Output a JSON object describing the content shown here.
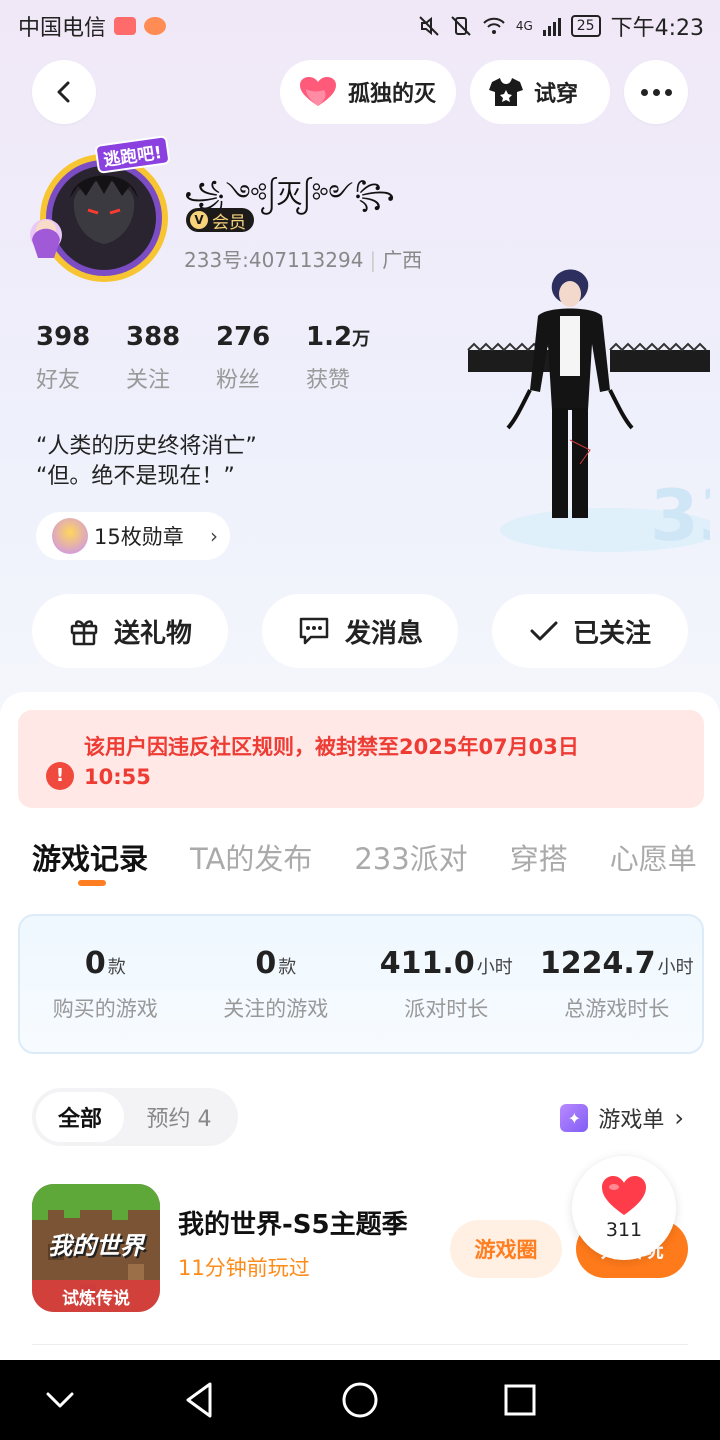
{
  "status_bar": {
    "carrier": "中国电信",
    "network": "4G",
    "battery": "25",
    "time": "下午4:23"
  },
  "header": {
    "favorite_label": "孤独的灭",
    "try_on_label": "试穿"
  },
  "profile": {
    "avatar_frame_text": "逃跑吧!",
    "nickname": "꧁༺ᩭ灭ᩭ༻꧂",
    "vip_label": "会员",
    "id_text": "233号:407113294",
    "region": "广西",
    "stats": [
      {
        "num": "398",
        "unit": "",
        "label": "好友"
      },
      {
        "num": "388",
        "unit": "",
        "label": "关注"
      },
      {
        "num": "276",
        "unit": "",
        "label": "粉丝"
      },
      {
        "num": "1.2",
        "unit": "万",
        "label": "获赞"
      }
    ],
    "bio_line1": "“人类的历史终将消亡”",
    "bio_line2": "“但。绝不是现在！”",
    "badges_label": "15枚勋章"
  },
  "actions": {
    "gift": "送礼物",
    "message": "发消息",
    "follow": "已关注"
  },
  "ban_notice": {
    "line1": "该用户因违反社区规则，被封禁至2025年07月03日",
    "line2": "10:55"
  },
  "tabs": [
    "游戏记录",
    "TA的发布",
    "233派对",
    "穿搭",
    "心愿单"
  ],
  "game_stats": [
    {
      "value": "0",
      "unit": "款",
      "label": "购买的游戏"
    },
    {
      "value": "0",
      "unit": "款",
      "label": "关注的游戏"
    },
    {
      "value": "411.0",
      "unit": "小时",
      "label": "派对时长"
    },
    {
      "value": "1224.7",
      "unit": "小时",
      "label": "总游戏时长"
    }
  ],
  "filter": {
    "all": "全部",
    "reserve": "预约 4",
    "game_list": "游戏单"
  },
  "games": [
    {
      "name": "我的世界-S5主题季",
      "time": "11分钟前玩过",
      "icon_text1": "我的世界",
      "icon_text2": "试炼传说",
      "circle_label": "游戏圈",
      "play_label": "开始玩"
    }
  ],
  "like": {
    "count": "311"
  },
  "colors": {
    "accent": "#ff7e21",
    "danger": "#ee3c35",
    "ban_bg": "#ffe8e6"
  }
}
